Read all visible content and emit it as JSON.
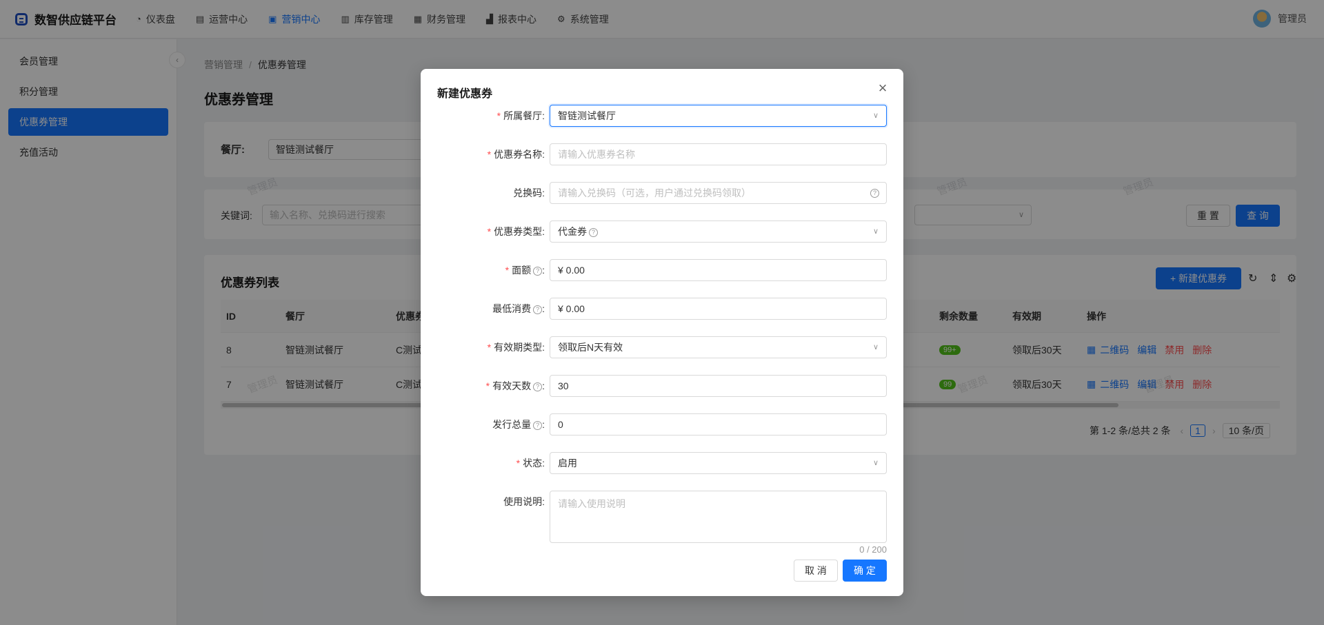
{
  "app": {
    "title": "数智供应链平台"
  },
  "nav": [
    {
      "icon": "dashboard-icon",
      "glyph": "◔",
      "label": "仪表盘",
      "active": false
    },
    {
      "icon": "operations-icon",
      "glyph": "▤",
      "label": "运营中心",
      "active": false
    },
    {
      "icon": "gift-icon",
      "glyph": "▣",
      "label": "营销中心",
      "active": true
    },
    {
      "icon": "inventory-icon",
      "glyph": "▥",
      "label": "库存管理",
      "active": false
    },
    {
      "icon": "finance-icon",
      "glyph": "▦",
      "label": "财务管理",
      "active": false
    },
    {
      "icon": "report-icon",
      "glyph": "▟",
      "label": "报表中心",
      "active": false
    },
    {
      "icon": "gear-icon",
      "glyph": "⚙",
      "label": "系统管理",
      "active": false
    }
  ],
  "user": {
    "name": "管理员"
  },
  "sidebar": {
    "items": [
      {
        "label": "会员管理",
        "active": false
      },
      {
        "label": "积分管理",
        "active": false
      },
      {
        "label": "优惠券管理",
        "active": true
      },
      {
        "label": "充值活动",
        "active": false
      }
    ]
  },
  "breadcrumb": {
    "parent": "营销管理",
    "separator": "/",
    "current": "优惠券管理"
  },
  "page_title": "优惠券管理",
  "filter": {
    "restaurant_label": "餐厅:",
    "restaurant_value": "智链测试餐厅",
    "keyword_label": "关键词:",
    "keyword_placeholder": "输入名称、兑换码进行搜索",
    "reset_label": "重 置",
    "query_label": "查 询"
  },
  "list": {
    "title": "优惠券列表",
    "new_button": "+ 新建优惠券",
    "columns": {
      "id": "ID",
      "restaurant": "餐厅",
      "coupon": "优惠券",
      "remaining": "剩余数量",
      "validity": "有效期",
      "actions": "操作"
    },
    "rows": [
      {
        "id": "8",
        "restaurant": "智链测试餐厅",
        "coupon": "C测试",
        "remaining": "99+",
        "validity": "领取后30天"
      },
      {
        "id": "7",
        "restaurant": "智链测试餐厅",
        "coupon": "C测试",
        "remaining": "99",
        "validity": "领取后30天"
      }
    ],
    "actions": {
      "qrcode": "二维码",
      "edit": "编辑",
      "disable": "禁用",
      "delete": "删除"
    },
    "pagination": {
      "summary": "第 1-2 条/总共 2 条",
      "page": "1",
      "page_size": "10 条/页"
    }
  },
  "watermark": "管理员",
  "modal": {
    "title": "新建优惠券",
    "fields": {
      "restaurant": {
        "label": "所属餐厅",
        "value": "智链测试餐厅"
      },
      "name": {
        "label": "优惠券名称",
        "placeholder": "请输入优惠券名称"
      },
      "code": {
        "label": "兑换码",
        "placeholder": "请输入兑换码（可选，用户通过兑换码领取）"
      },
      "type": {
        "label": "优惠券类型",
        "value": "代金券"
      },
      "face_value": {
        "label": "面额",
        "value": "¥ 0.00"
      },
      "min_spend": {
        "label": "最低消费",
        "value": "¥ 0.00"
      },
      "validity_type": {
        "label": "有效期类型",
        "value": "领取后N天有效"
      },
      "valid_days": {
        "label": "有效天数",
        "value": "30"
      },
      "total": {
        "label": "发行总量",
        "value": "0"
      },
      "status": {
        "label": "状态",
        "value": "启用"
      },
      "description": {
        "label": "使用说明",
        "placeholder": "请输入使用说明"
      }
    },
    "counter": "0 / 200",
    "cancel": "取 消",
    "ok": "确 定"
  }
}
